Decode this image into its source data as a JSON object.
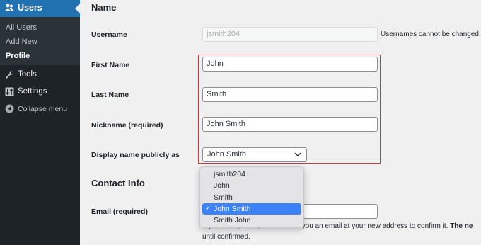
{
  "sidebar": {
    "current_menu": "Users",
    "submenu": [
      "All Users",
      "Add New",
      "Profile"
    ],
    "current_submenu": "Profile",
    "items": [
      {
        "label": "Tools",
        "icon": "wrench-icon"
      },
      {
        "label": "Settings",
        "icon": "settings-icon"
      }
    ],
    "collapse_label": "Collapse menu"
  },
  "form": {
    "name_section_title": "Name",
    "username": {
      "label": "Username",
      "value": "jsmith204",
      "description": "Usernames cannot be changed."
    },
    "first_name": {
      "label": "First Name",
      "value": "John"
    },
    "last_name": {
      "label": "Last Name",
      "value": "Smith"
    },
    "nickname": {
      "label": "Nickname (required)",
      "value": "John Smith"
    },
    "display_name": {
      "label": "Display name publicly as",
      "value": "John Smith",
      "options": [
        "jsmith204",
        "John",
        "Smith",
        "John Smith",
        "Smith John"
      ],
      "selected_option": "John Smith",
      "check_mark": "✓"
    },
    "contact_section_title": "Contact Info",
    "email": {
      "label": "Email (required)",
      "description_partial": "If you change this, we will send you an email at your new address to confirm it.",
      "description_bold_partial": "The ne",
      "description_line2": "until confirmed."
    }
  },
  "colors": {
    "sidebar_bg": "#1d2327",
    "accent": "#2271b1",
    "highlight_border": "#d63638",
    "dropdown_selected": "#3b82f6"
  }
}
